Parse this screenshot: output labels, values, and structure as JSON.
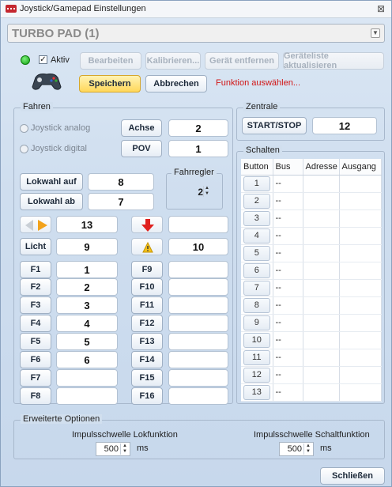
{
  "window": {
    "title": "Joystick/Gamepad Einstellungen",
    "close_glyph": "⊠"
  },
  "device": {
    "selected": "TURBO PAD (1)"
  },
  "status": {
    "active_label": "Aktiv",
    "active_checked": true,
    "led_color": "#1fb51f"
  },
  "toolbar": {
    "edit": "Bearbeiten",
    "calibrate": "Kalibrieren...",
    "remove": "Gerät entfernen",
    "refresh": "Geräteliste aktualisieren",
    "save": "Speichern",
    "cancel": "Abbrechen",
    "hint": "Funktion auswählen..."
  },
  "fahren": {
    "title": "Fahren",
    "radio_analog": "Joystick analog",
    "radio_digital": "Joystick digital",
    "achse_label": "Achse",
    "achse_value": "2",
    "pov_label": "POV",
    "pov_value": "1",
    "lokwahl_auf": "Lokwahl auf",
    "lokwahl_auf_value": "8",
    "lokwahl_ab": "Lokwahl ab",
    "lokwahl_ab_value": "7",
    "fahrregler_title": "Fahrregler",
    "fahrregler_value": "2",
    "direction_value": "13",
    "stop_value": "",
    "licht": "Licht",
    "licht_value": "9",
    "warn_value": "10",
    "functions_left": [
      {
        "label": "F1",
        "value": "1"
      },
      {
        "label": "F2",
        "value": "2"
      },
      {
        "label": "F3",
        "value": "3"
      },
      {
        "label": "F4",
        "value": "4"
      },
      {
        "label": "F5",
        "value": "5"
      },
      {
        "label": "F6",
        "value": "6"
      },
      {
        "label": "F7",
        "value": ""
      },
      {
        "label": "F8",
        "value": ""
      }
    ],
    "functions_right": [
      {
        "label": "F9",
        "value": ""
      },
      {
        "label": "F10",
        "value": ""
      },
      {
        "label": "F11",
        "value": ""
      },
      {
        "label": "F12",
        "value": ""
      },
      {
        "label": "F13",
        "value": ""
      },
      {
        "label": "F14",
        "value": ""
      },
      {
        "label": "F15",
        "value": ""
      },
      {
        "label": "F16",
        "value": ""
      }
    ]
  },
  "zentrale": {
    "title": "Zentrale",
    "button": "START/STOP",
    "value": "12"
  },
  "schalten": {
    "title": "Schalten",
    "columns": [
      "Button",
      "Bus",
      "Adresse",
      "Ausgang"
    ],
    "rows": [
      {
        "button": "1",
        "bus": "--"
      },
      {
        "button": "2",
        "bus": "--"
      },
      {
        "button": "3",
        "bus": "--"
      },
      {
        "button": "4",
        "bus": "--"
      },
      {
        "button": "5",
        "bus": "--"
      },
      {
        "button": "6",
        "bus": "--"
      },
      {
        "button": "7",
        "bus": "--"
      },
      {
        "button": "8",
        "bus": "--"
      },
      {
        "button": "9",
        "bus": "--"
      },
      {
        "button": "10",
        "bus": "--"
      },
      {
        "button": "11",
        "bus": "--"
      },
      {
        "button": "12",
        "bus": "--"
      },
      {
        "button": "13",
        "bus": "--"
      }
    ]
  },
  "options": {
    "title": "Erweiterte Optionen",
    "lok_label": "Impulsschwelle Lokfunktion",
    "lok_value": "500",
    "lok_unit": "ms",
    "schalt_label": "Impulsschwelle Schaltfunktion",
    "schalt_value": "500",
    "schalt_unit": "ms"
  },
  "footer": {
    "close": "Schließen"
  }
}
